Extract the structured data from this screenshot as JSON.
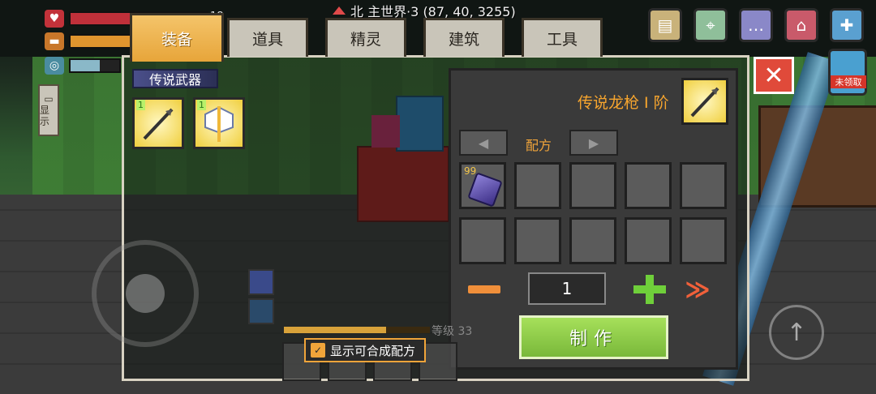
{
  "hud": {
    "hp_value": "18",
    "hp_fraction": 0.55,
    "hunger_fraction": 0.85,
    "oxygen_fraction": 0.6,
    "location": "北  主世界·3  (87, 40, 3255)"
  },
  "tabs": [
    {
      "label": "装备",
      "active": true
    },
    {
      "label": "道具",
      "active": false
    },
    {
      "label": "精灵",
      "active": false
    },
    {
      "label": "建筑",
      "active": false
    },
    {
      "label": "工具",
      "active": false
    }
  ],
  "top_icons": [
    "scroll-icon",
    "map-icon",
    "chat-icon",
    "shop-icon",
    "plus-icon"
  ],
  "side_button": {
    "label": "显示"
  },
  "category": {
    "label": "传说武器"
  },
  "weapons": [
    {
      "name": "spear-icon",
      "level": "1"
    },
    {
      "name": "axe-icon",
      "level": "1"
    }
  ],
  "detail": {
    "item_name": "传说龙枪 I 阶",
    "item_level": "1",
    "recipe_label": "配方",
    "ingredients": [
      {
        "count": "99",
        "icon": "purple-gem-icon"
      }
    ],
    "quantity": "1",
    "make_label": "制作",
    "max_symbol": "≫"
  },
  "show_recipes_label": "显示可合成配方",
  "level_text": "等级 33",
  "unclaimed_label": "未领取",
  "colors": {
    "accent": "#f0a43a",
    "make": "#8cc84a",
    "close": "#e04a3a"
  }
}
